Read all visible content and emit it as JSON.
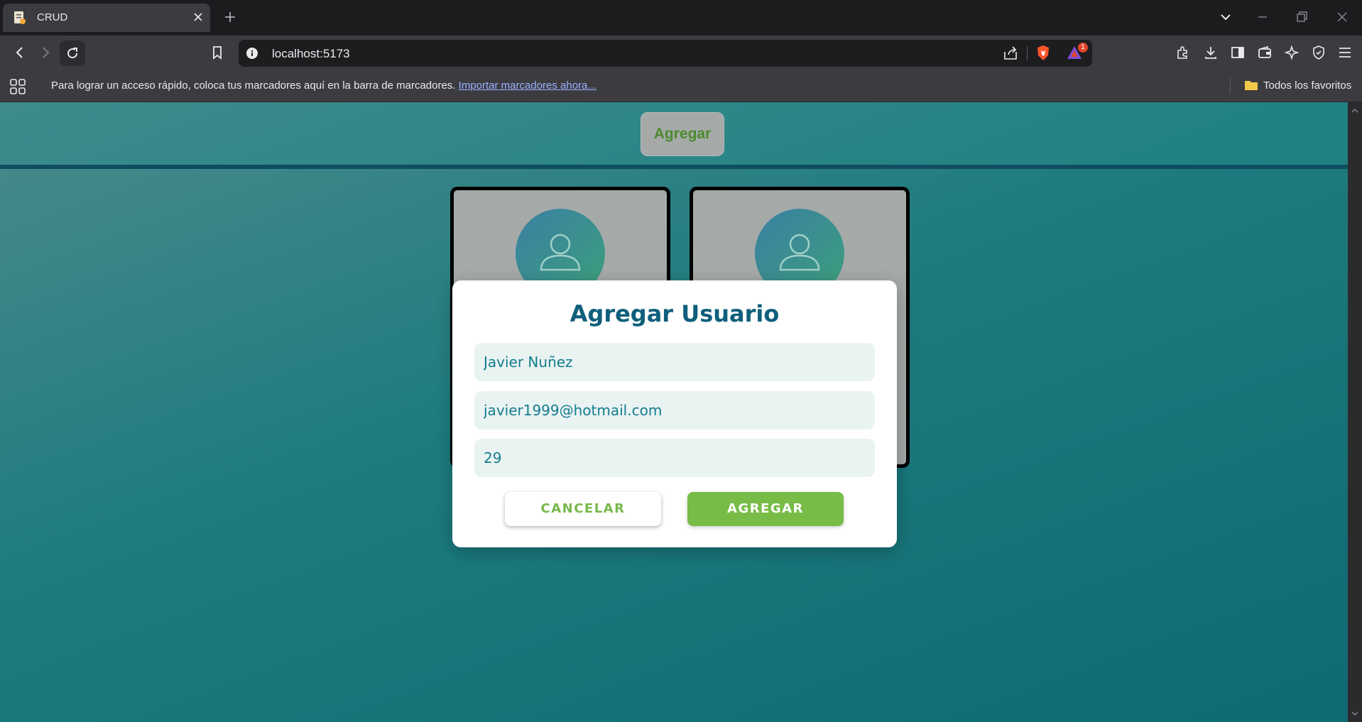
{
  "browser": {
    "tab_title": "CRUD",
    "url": "localhost:5173",
    "rewards_badge": "1",
    "bookmarks_hint": "Para lograr un acceso rápido, coloca tus marcadores aquí en la barra de marcadores.",
    "bookmarks_import_link": "Importar marcadores ahora...",
    "all_favorites": "Todos los favoritos"
  },
  "page": {
    "add_button_label": "Agregar",
    "cards": [
      {
        "avatar_icon": "user-icon"
      },
      {
        "avatar_icon": "user-icon"
      }
    ]
  },
  "modal": {
    "title": "Agregar Usuario",
    "fields": {
      "name": "Javier Nuñez",
      "email": "javier1999@hotmail.com",
      "age": "29"
    },
    "cancel_label": "CANCELAR",
    "submit_label": "AGREGAR"
  },
  "colors": {
    "modal_title": "#0f5f7c",
    "field_text": "#157c8e",
    "primary_green": "#77bc47",
    "card_bg": "#a5aaa9"
  }
}
